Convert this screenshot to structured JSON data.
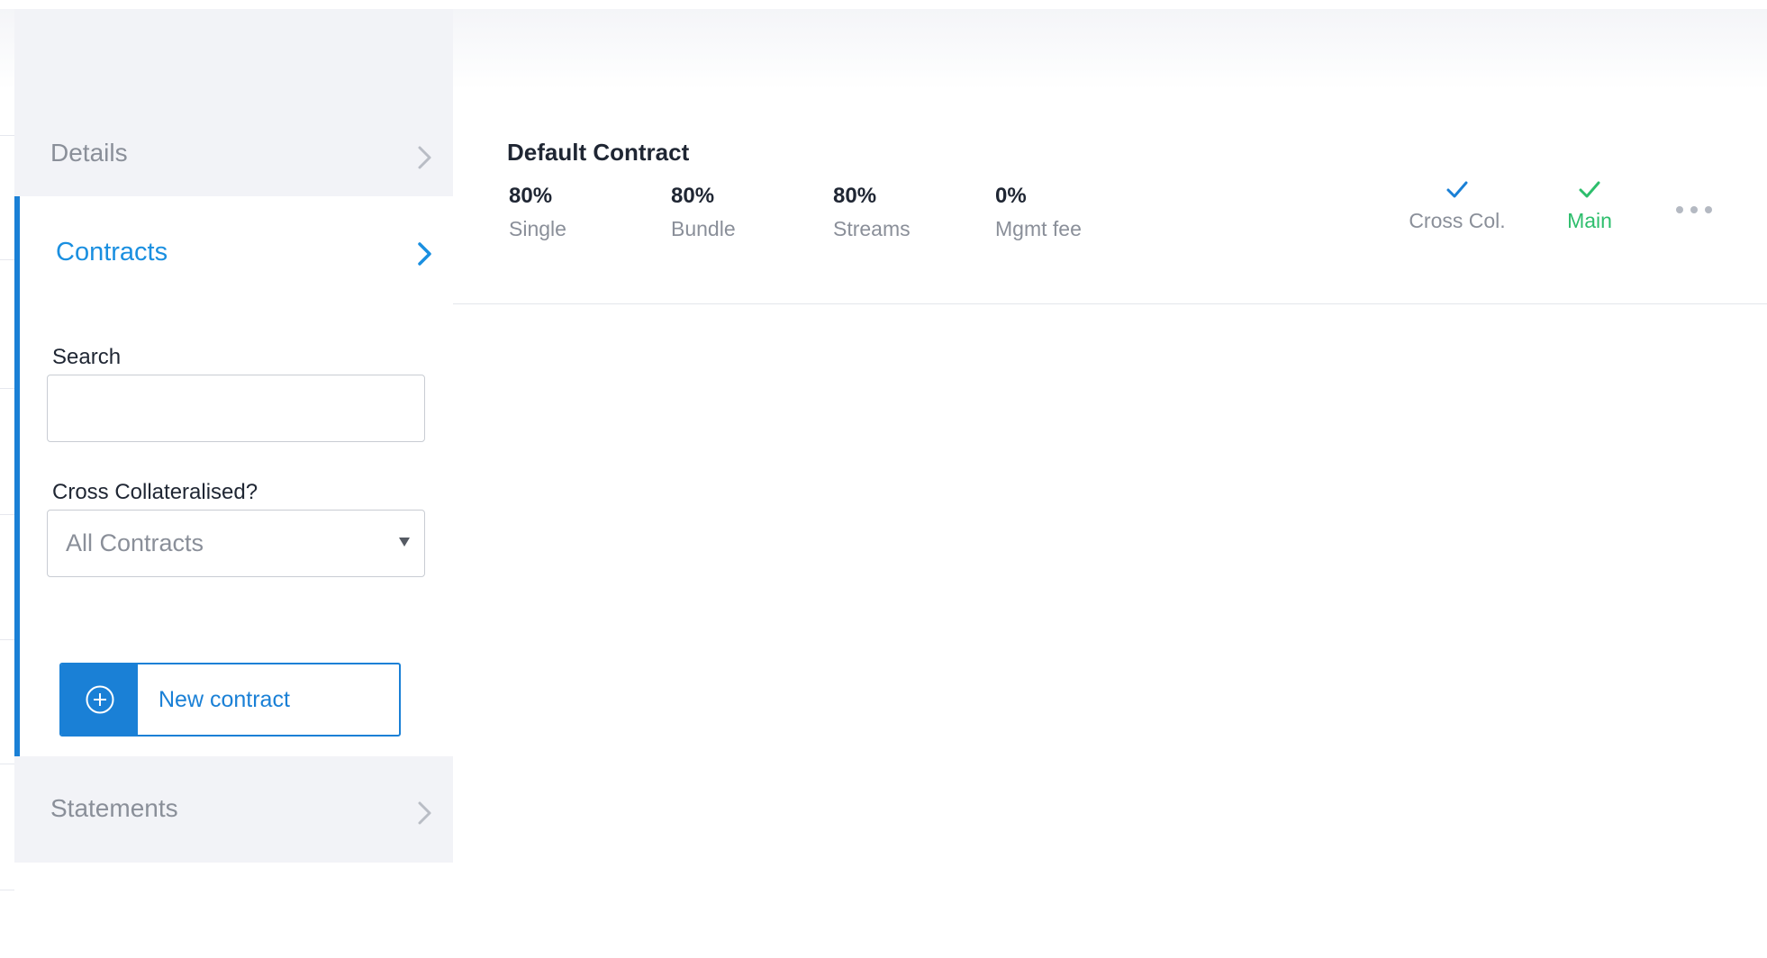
{
  "sidebar": {
    "details_label": "Details",
    "contracts_label": "Contracts",
    "statements_label": "Statements",
    "search": {
      "label": "Search",
      "value": "",
      "placeholder": ""
    },
    "cross_filter": {
      "label": "Cross Collateralised?",
      "selected": "All Contracts"
    },
    "new_contract_label": "New contract"
  },
  "contract": {
    "title": "Default Contract",
    "stats": [
      {
        "value": "80%",
        "label": "Single"
      },
      {
        "value": "80%",
        "label": "Bundle"
      },
      {
        "value": "80%",
        "label": "Streams"
      },
      {
        "value": "0%",
        "label": "Mgmt fee"
      }
    ],
    "cross_col": {
      "label": "Cross Col.",
      "icon": "check-icon",
      "color": "#1a80d6"
    },
    "main": {
      "label": "Main",
      "icon": "check-icon",
      "color": "#2dbe6c"
    },
    "more_icon": "more-icon"
  },
  "colors": {
    "accent": "#1a80d6",
    "success": "#2dbe6c",
    "muted_text": "#8a8f99",
    "sidebar_bg": "#f2f3f7"
  }
}
